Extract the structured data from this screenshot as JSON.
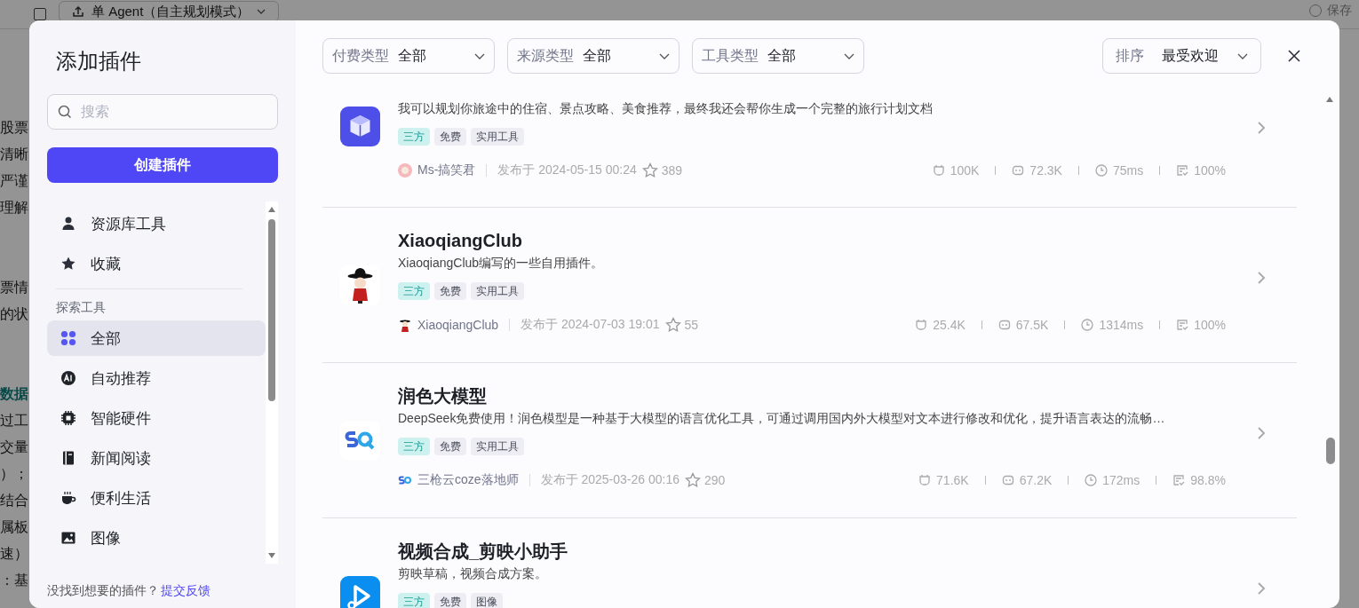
{
  "background_page": {
    "toolbar": {
      "mode_button": "单 Agent（自主规划模式）",
      "save": "保存"
    },
    "paragraphs": [
      [
        "股票",
        "清晰",
        "严谨",
        "理解"
      ],
      [
        "票情",
        "的状"
      ],
      [
        "数据",
        "过工",
        "交量",
        "）；",
        "结合",
        "属板",
        "速）",
        "：基"
      ]
    ]
  },
  "dialog": {
    "title": "添加插件",
    "search": {
      "placeholder": "搜索"
    },
    "create_button": "创建插件",
    "sidebar": {
      "top_items": [
        {
          "label": "资源库工具",
          "selected": false
        },
        {
          "label": "收藏",
          "selected": false
        }
      ],
      "section": "探索工具",
      "items": [
        {
          "label": "全部",
          "selected": true
        },
        {
          "label": "自动推荐",
          "selected": false
        },
        {
          "label": "智能硬件",
          "selected": false
        },
        {
          "label": "新闻阅读",
          "selected": false
        },
        {
          "label": "便利生活",
          "selected": false
        },
        {
          "label": "图像",
          "selected": false
        }
      ]
    },
    "footer": {
      "text": "没找到想要的插件？",
      "link": "提交反馈"
    },
    "filters": [
      {
        "label": "付费类型",
        "value": "全部"
      },
      {
        "label": "来源类型",
        "value": "全部"
      },
      {
        "label": "工具类型",
        "value": "全部"
      }
    ],
    "sort": {
      "label": "排序",
      "value": "最受欢迎"
    },
    "plugins": [
      {
        "description": "我可以规划你旅途中的住宿、景点攻略、美食推荐，最终我还会帮你生成一个完整的旅行计划文档",
        "tags": [
          {
            "text": "三方",
            "color": "#cdf1ef"
          },
          {
            "text": "免费",
            "color": "#ededf3"
          },
          {
            "text": "实用工具",
            "color": "#ededf3"
          }
        ],
        "author": "Ms-搞笑君",
        "published": "发布于 2024-05-15 00:24",
        "favorites": "389",
        "stats": [
          "100K",
          "72.3K",
          "75ms",
          "100%"
        ]
      },
      {
        "title": "XiaoqiangClub",
        "description": "XiaoqiangClub编写的一些自用插件。",
        "tags": [
          {
            "text": "三方",
            "color": "#cdf1ef"
          },
          {
            "text": "免费",
            "color": "#ededf3"
          },
          {
            "text": "实用工具",
            "color": "#ededf3"
          }
        ],
        "author": "XiaoqiangClub",
        "published": "发布于 2024-07-03 19:01",
        "favorites": "55",
        "stats": [
          "25.4K",
          "67.5K",
          "1314ms",
          "100%"
        ]
      },
      {
        "title": "润色大模型",
        "description": "DeepSeek免费使用！润色模型是一种基于大模型的语言优化工具，可通过调用国内外大模型对文本进行修改和优化，提升语言表达的流畅…",
        "tags": [
          {
            "text": "三方",
            "color": "#cdf1ef"
          },
          {
            "text": "免费",
            "color": "#ededf3"
          },
          {
            "text": "实用工具",
            "color": "#ededf3"
          }
        ],
        "author": "三枪云coze落地师",
        "published": "发布于 2025-03-26 00:16",
        "favorites": "290",
        "stats": [
          "71.6K",
          "67.2K",
          "172ms",
          "98.8%"
        ]
      },
      {
        "title": "视频合成_剪映小助手",
        "description": "剪映草稿，视频合成方案。",
        "tags": [
          {
            "text": "三方",
            "color": "#cdf1ef"
          },
          {
            "text": "免费",
            "color": "#ededf3"
          },
          {
            "text": "图像",
            "color": "#ededf3"
          }
        ]
      }
    ]
  }
}
